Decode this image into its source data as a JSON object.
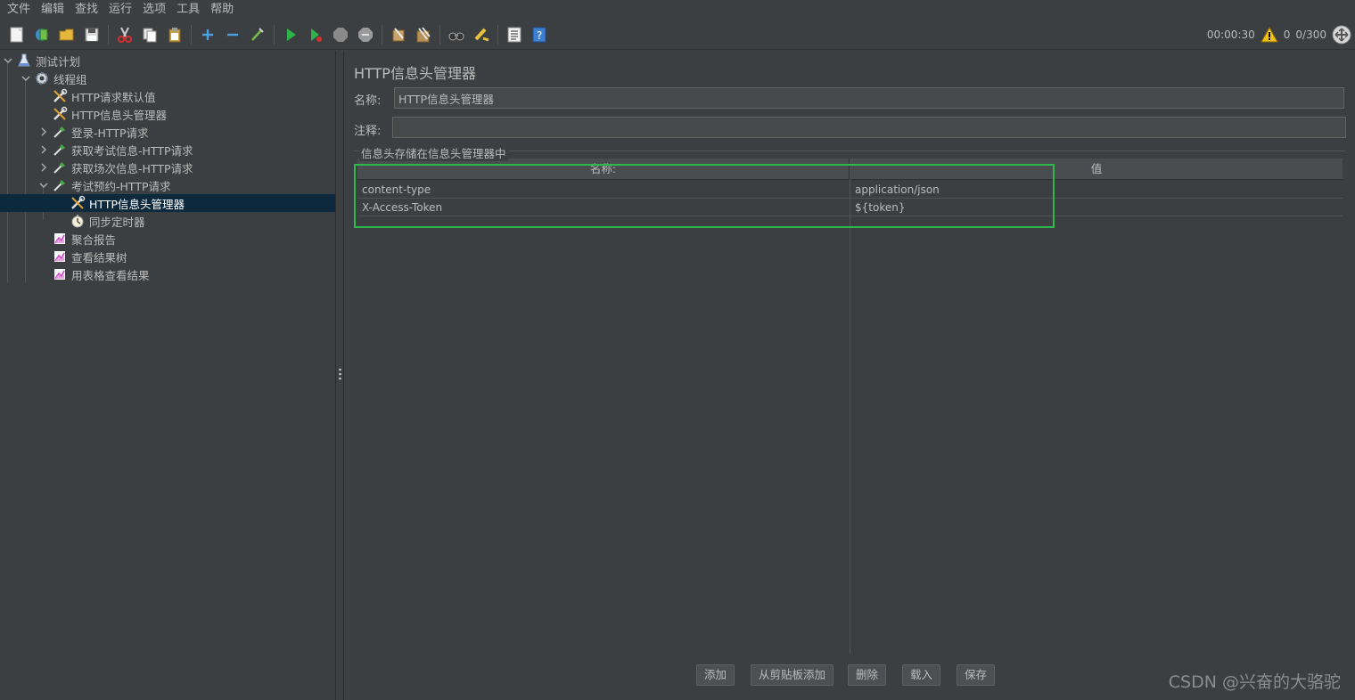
{
  "menu": [
    "文件",
    "编辑",
    "查找",
    "运行",
    "选项",
    "工具",
    "帮助"
  ],
  "toolbar": {
    "icons": [
      "new-icon",
      "templates-icon",
      "open-icon",
      "save-icon",
      "cut-icon",
      "copy-icon",
      "paste-icon",
      "expand-icon",
      "collapse-icon",
      "toggle-icon",
      "start-icon",
      "start-no-pause-icon",
      "stop-icon",
      "shutdown-icon",
      "clear-icon",
      "clear-all-icon",
      "search-icon",
      "reset-search-icon",
      "function-helper-icon",
      "help-icon"
    ],
    "timer": "00:00:30",
    "warn_count": "0",
    "threads": "0/300"
  },
  "tree": {
    "items": [
      {
        "label": "测试计划",
        "icon": "test-plan-icon",
        "arrow": "down"
      },
      {
        "label": "线程组",
        "icon": "gear-icon",
        "arrow": "down"
      },
      {
        "label": "HTTP请求默认值",
        "icon": "wrench-icon",
        "arrow": ""
      },
      {
        "label": "HTTP信息头管理器",
        "icon": "wrench-icon",
        "arrow": ""
      },
      {
        "label": "登录-HTTP请求",
        "icon": "pipette-icon",
        "arrow": "right"
      },
      {
        "label": "获取考试信息-HTTP请求",
        "icon": "pipette-icon",
        "arrow": "right"
      },
      {
        "label": "获取场次信息-HTTP请求",
        "icon": "pipette-icon",
        "arrow": "right"
      },
      {
        "label": "考试预约-HTTP请求",
        "icon": "pipette-icon",
        "arrow": "down"
      },
      {
        "label": "HTTP信息头管理器",
        "icon": "wrench-icon",
        "arrow": "",
        "selected": true
      },
      {
        "label": "同步定时器",
        "icon": "timer-icon",
        "arrow": ""
      },
      {
        "label": "聚合报告",
        "icon": "report-icon",
        "arrow": ""
      },
      {
        "label": "查看结果树",
        "icon": "report-icon",
        "arrow": ""
      },
      {
        "label": "用表格查看结果",
        "icon": "report-icon",
        "arrow": ""
      }
    ]
  },
  "panel": {
    "title": "HTTP信息头管理器",
    "name_label": "名称:",
    "name_value": "HTTP信息头管理器",
    "comment_label": "注释:",
    "comment_value": "",
    "group_title": "信息头存储在信息头管理器中",
    "table": {
      "columns": [
        "名称:",
        "值"
      ],
      "rows": [
        [
          "content-type",
          "application/json"
        ],
        [
          "X-Access-Token",
          "${token}"
        ]
      ]
    },
    "buttons": {
      "add": "添加",
      "add_clipboard": "从剪贴板添加",
      "delete": "删除",
      "load": "载入",
      "save": "保存"
    }
  },
  "watermark": "CSDN @兴奋的大骆驼",
  "colors": {
    "background": "#3c3f41",
    "selection": "#0d293e",
    "highlight": "#2fb84b"
  }
}
